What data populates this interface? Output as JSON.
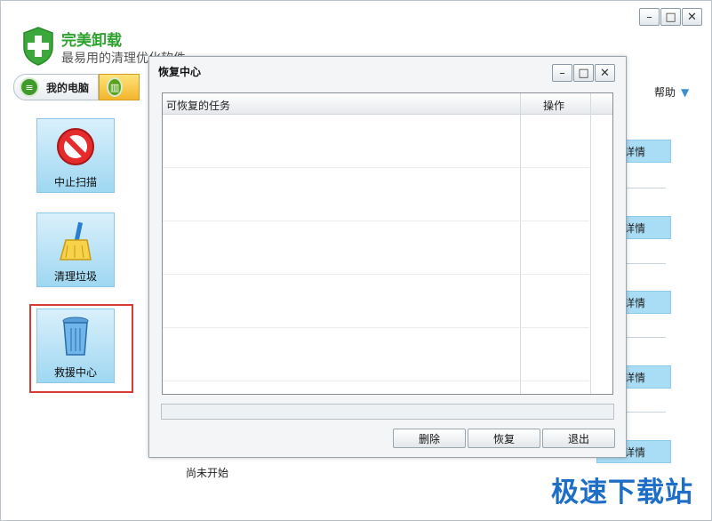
{
  "app": {
    "title": "完美卸载",
    "subtitle": "最易用的清理优化软件"
  },
  "window_controls": {
    "minimize": "–",
    "maximize": "□",
    "close": "✕"
  },
  "tabs": [
    {
      "label": "我的电脑",
      "icon": "list-icon"
    },
    {
      "label": "",
      "icon": "trash-icon"
    }
  ],
  "help": {
    "label": "帮助",
    "icon": "chevron-down-icon"
  },
  "sidebar": {
    "items": [
      {
        "label": "中止扫描",
        "icon": "stop-icon"
      },
      {
        "label": "清理垃圾",
        "icon": "broom-icon"
      },
      {
        "label": "救援中心",
        "icon": "recycle-bin-icon"
      }
    ]
  },
  "background_list": {
    "detail_label": "看详情",
    "status": "尚未开始"
  },
  "dialog": {
    "title": "恢复中心",
    "columns": {
      "task": "可恢复的任务",
      "operation": "操作"
    },
    "rows": [],
    "buttons": {
      "delete": "删除",
      "restore": "恢复",
      "exit": "退出"
    }
  },
  "watermark": "极速下载站"
}
